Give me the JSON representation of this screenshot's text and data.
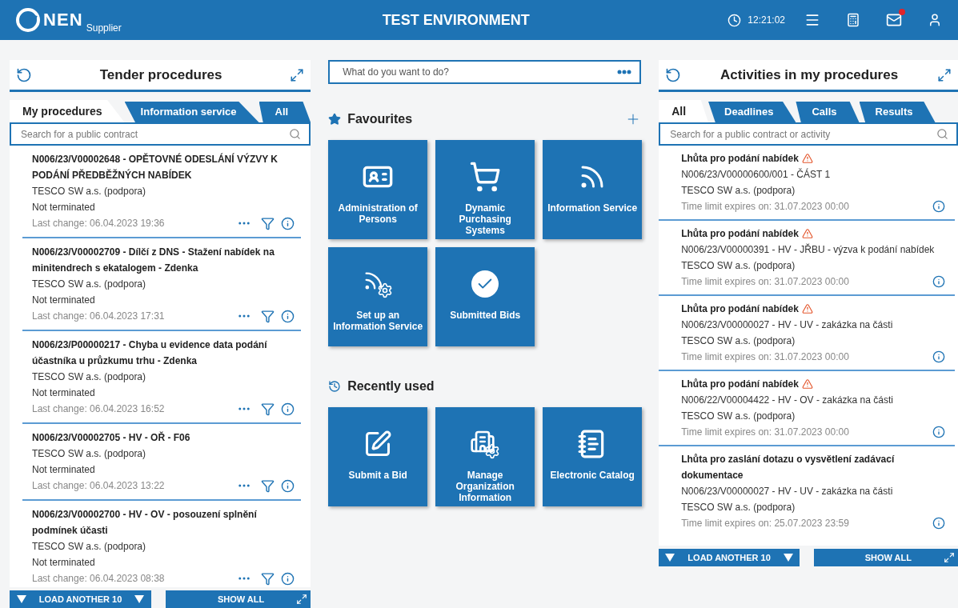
{
  "header": {
    "logo_text": "NEN",
    "logo_sub": "Supplier",
    "title": "TEST ENVIRONMENT",
    "time": "12:21:02",
    "mail_unread": true
  },
  "left_panel": {
    "title": "Tender procedures",
    "tabs": [
      {
        "label": "My procedures",
        "selected": true
      },
      {
        "label": "Information service",
        "selected": false
      },
      {
        "label": "All",
        "selected": false
      }
    ],
    "search": {
      "placeholder": "Search for a public contract"
    },
    "items": [
      {
        "title": "N006/23/V00002648 - OPĚTOVNÉ ODESLÁNÍ VÝZVY K PODÁNÍ PŘEDBĚŽNÝCH NABÍDEK",
        "org": "TESCO SW a.s. (podpora)",
        "status": "Not terminated",
        "last_change": "Last change: 06.04.2023 19:36"
      },
      {
        "title": "N006/23/V00002709 - Dílčí z DNS - Stažení nabídek na minitendrech s ekatalogem - Zdenka",
        "org": "TESCO SW a.s. (podpora)",
        "status": "Not terminated",
        "last_change": "Last change: 06.04.2023 17:31"
      },
      {
        "title": "N006/23/P00000217 - Chyba u evidence data podání účastníka u průzkumu trhu - Zdenka",
        "org": "TESCO SW a.s. (podpora)",
        "status": "Not terminated",
        "last_change": "Last change: 06.04.2023 16:52"
      },
      {
        "title": "N006/23/V00002705 - HV - OŘ - F06",
        "org": "TESCO SW a.s. (podpora)",
        "status": "Not terminated",
        "last_change": "Last change: 06.04.2023 13:22"
      },
      {
        "title": "N006/23/V00002700 - HV - OV - posouzení splnění podmínek účasti",
        "org": "TESCO SW a.s. (podpora)",
        "status": "Not terminated",
        "last_change": "Last change: 06.04.2023 08:38"
      }
    ],
    "load_more": "LOAD ANOTHER 10",
    "show_all": "SHOW ALL"
  },
  "center": {
    "command": {
      "placeholder": "What do you want to do?"
    },
    "favourites": {
      "title": "Favourites",
      "tiles": [
        {
          "label": "Administration of Persons"
        },
        {
          "label": "Dynamic Purchasing Systems"
        },
        {
          "label": "Information Service"
        },
        {
          "label": "Set up an Information Service"
        },
        {
          "label": "Submitted Bids"
        }
      ]
    },
    "recent": {
      "title": "Recently used",
      "tiles": [
        {
          "label": "Submit a Bid"
        },
        {
          "label": "Manage Organization Information"
        },
        {
          "label": "Electronic Catalog"
        }
      ]
    }
  },
  "right_panel": {
    "title": "Activities in my procedures",
    "tabs": [
      {
        "label": "All",
        "selected": true
      },
      {
        "label": "Deadlines",
        "selected": false
      },
      {
        "label": "Calls",
        "selected": false
      },
      {
        "label": "Results",
        "selected": false
      }
    ],
    "search": {
      "placeholder": "Search for a public contract or activity"
    },
    "items": [
      {
        "title": "Lhůta pro podání nabídek",
        "warning": true,
        "procedure": "N006/23/V00000600/001 - ČÁST 1",
        "org": "TESCO SW a.s. (podpora)",
        "expires": "Time limit expires on: 31.07.2023 00:00"
      },
      {
        "title": "Lhůta pro podání nabídek",
        "warning": true,
        "procedure": "N006/23/V00000391 - HV - JŘBU - výzva k podání nabídek",
        "org": "TESCO SW a.s. (podpora)",
        "expires": "Time limit expires on: 31.07.2023 00:00"
      },
      {
        "title": "Lhůta pro podání nabídek",
        "warning": true,
        "procedure": "N006/23/V00000027 - HV - UV - zakázka na části",
        "org": "TESCO SW a.s. (podpora)",
        "expires": "Time limit expires on: 31.07.2023 00:00"
      },
      {
        "title": "Lhůta pro podání nabídek",
        "warning": true,
        "procedure": "N006/22/V00004422 - HV - OV - zakázka na části",
        "org": "TESCO SW a.s. (podpora)",
        "expires": "Time limit expires on: 31.07.2023 00:00"
      },
      {
        "title": "Lhůta pro zaslání dotazu o vysvětlení zadávací dokumentace",
        "warning": false,
        "procedure": "N006/23/V00000027 - HV - UV - zakázka na části",
        "org": "TESCO SW a.s. (podpora)",
        "expires": "Time limit expires on: 25.07.2023 23:59"
      }
    ],
    "load_more": "LOAD ANOTHER 10",
    "show_all": "SHOW ALL"
  }
}
